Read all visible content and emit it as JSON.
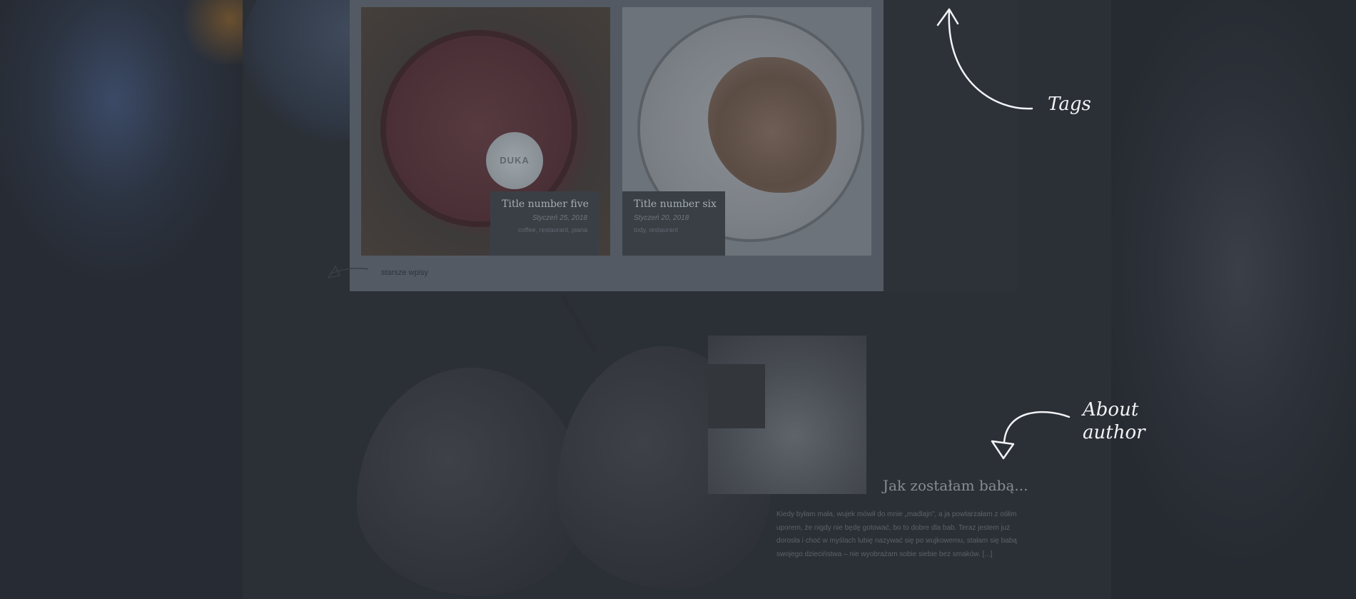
{
  "posts": [
    {
      "title": "Title number five",
      "date": "Styczeń 25, 2018",
      "tags": "coffee, restaurant, piana",
      "image_icon": "cast-iron-pot-photo",
      "pot_brand": "DUKA"
    },
    {
      "title": "Title number six",
      "date": "Styczeń 20, 2018",
      "tags": "tody, restaurant",
      "image_icon": "plated-food-photo"
    }
  ],
  "pagination": {
    "older_label": "starsze wpisy",
    "icon": "hand-drawn-arrow-left-icon"
  },
  "about_author": {
    "title": "Jak zostałam babą...",
    "text": "Kiedy byłam mała, wujek mówił do mnie „madlajn\", a ja powtarzałam z ośłim uporem, że nigdy nie będę gotować, bo to dobre dla bab. Teraz jestem już dorosła i choć w myślach lubię nazywać się po wujkowemu, stałam się babą swojego dzieciństwa – nie wyobrażam sobie siebie bez smaków. [...]",
    "photo_icon": "author-photo"
  },
  "annotations": {
    "tags_label": "Tags",
    "author_label_line1": "About",
    "author_label_line2": "author"
  },
  "colors": {
    "overlay_dark": "#2b2f36",
    "panel": "#535a63",
    "annotation": "#f1f3f5"
  }
}
